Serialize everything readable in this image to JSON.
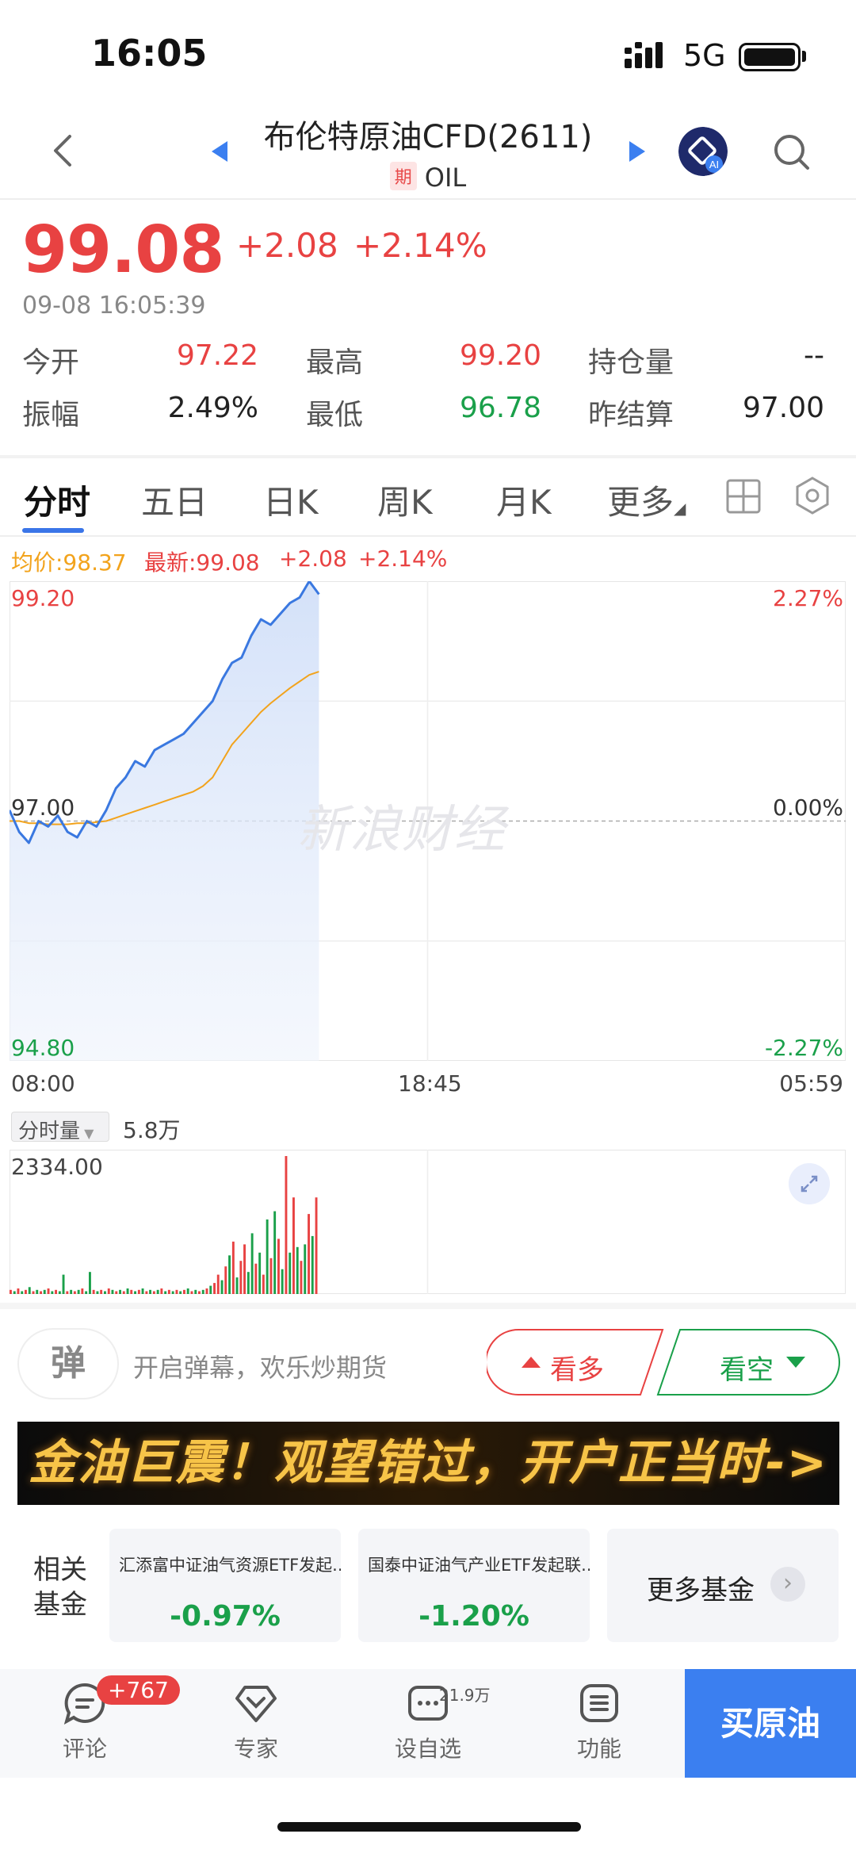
{
  "status": {
    "time": "16:05",
    "network": "5G"
  },
  "nav": {
    "title": "布伦特原油CFD(2611)",
    "tag": "期",
    "code": "OIL"
  },
  "quote": {
    "price": "99.08",
    "change": "+2.08",
    "change_pct": "+2.14%",
    "datetime": "09-08 16:05:39"
  },
  "stats": [
    {
      "label": "今开",
      "value": "97.22",
      "color": "red"
    },
    {
      "label": "最高",
      "value": "99.20",
      "color": "red"
    },
    {
      "label": "持仓量",
      "value": "--",
      "color": "dark"
    },
    {
      "label": "振幅",
      "value": "2.49%",
      "color": "dark"
    },
    {
      "label": "最低",
      "value": "96.78",
      "color": "green"
    },
    {
      "label": "昨结算",
      "value": "97.00",
      "color": "dark"
    }
  ],
  "tabs": [
    "分时",
    "五日",
    "日K",
    "周K",
    "月K",
    "更多"
  ],
  "legend": {
    "avg": "均价:98.37",
    "last": "最新:99.08",
    "chg": "+2.08",
    "pct": "+2.14%"
  },
  "chart": {
    "y_top": "99.20",
    "y_mid": "97.00",
    "y_bottom": "94.80",
    "pct_top": "2.27%",
    "pct_mid": "0.00%",
    "pct_bottom": "-2.27%",
    "x_start": "08:00",
    "x_mid": "18:45",
    "x_end": "05:59",
    "watermark": "新浪财经",
    "colors": {
      "price": "#3a78e0",
      "avg": "#f2a31c",
      "up": "#e84242",
      "down": "#1aa04a"
    }
  },
  "chart_data": {
    "type": "line",
    "title": "",
    "ylim": [
      94.8,
      99.2
    ],
    "x_labels": [
      "08:00",
      "18:45",
      "05:59"
    ],
    "series": [
      {
        "values": [
          97.1,
          96.9,
          96.8,
          97.0,
          96.95,
          97.05,
          96.9,
          96.85,
          97.0,
          96.95,
          97.1,
          97.3,
          97.4,
          97.55,
          97.5,
          97.65,
          97.7,
          97.75,
          97.8,
          97.9,
          98.0,
          98.1,
          98.3,
          98.45,
          98.5,
          98.7,
          98.85,
          98.8,
          98.9,
          99.0,
          99.05,
          99.2,
          99.08
        ]
      },
      {
        "values": [
          97.0,
          97.0,
          96.98,
          96.98,
          96.97,
          96.97,
          96.97,
          96.98,
          96.98,
          96.99,
          97.0,
          97.03,
          97.06,
          97.09,
          97.12,
          97.15,
          97.18,
          97.21,
          97.24,
          97.27,
          97.32,
          97.4,
          97.55,
          97.7,
          97.8,
          97.9,
          98.0,
          98.08,
          98.15,
          98.22,
          98.28,
          98.34,
          98.37
        ]
      }
    ]
  },
  "volume": {
    "button": "分时量",
    "total": "5.8万",
    "max_label": "2334.00",
    "bars": [
      3,
      2,
      4,
      2,
      3,
      5,
      2,
      3,
      2,
      3,
      4,
      2,
      3,
      2,
      14,
      2,
      3,
      2,
      3,
      4,
      2,
      16,
      3,
      2,
      3,
      2,
      4,
      3,
      2,
      3,
      2,
      4,
      3,
      2,
      3,
      4,
      2,
      3,
      2,
      3,
      4,
      2,
      3,
      2,
      3,
      2,
      3,
      4,
      2,
      3,
      2,
      3,
      4,
      6,
      8,
      14,
      10,
      20,
      28,
      38,
      12,
      24,
      36,
      16,
      44,
      22,
      30,
      14,
      54,
      26,
      60,
      40,
      18,
      100,
      30,
      70,
      34,
      24,
      36,
      58,
      42,
      70
    ],
    "bar_colors": [
      "r",
      "g",
      "r",
      "g",
      "r",
      "g",
      "r",
      "g",
      "r",
      "g",
      "r",
      "g",
      "r",
      "g",
      "g",
      "r",
      "g",
      "r",
      "g",
      "r",
      "g",
      "g",
      "r",
      "g",
      "r",
      "g",
      "r",
      "g",
      "r",
      "g",
      "r",
      "g",
      "r",
      "g",
      "r",
      "g",
      "r",
      "g",
      "r",
      "g",
      "r",
      "g",
      "r",
      "g",
      "r",
      "g",
      "r",
      "g",
      "r",
      "g",
      "r",
      "g",
      "r",
      "g",
      "r",
      "r",
      "g",
      "r",
      "g",
      "r",
      "g",
      "r",
      "r",
      "g",
      "g",
      "r",
      "g",
      "r",
      "g",
      "r",
      "g",
      "r",
      "g",
      "r",
      "g",
      "r",
      "g",
      "r",
      "g",
      "r",
      "g",
      "r"
    ]
  },
  "barrage": {
    "icon": "弹",
    "placeholder": "开启弹幕，欢乐炒期货",
    "bull": "看多",
    "bear": "看空"
  },
  "banner": {
    "text": "金油巨震！观望错过，开户正当时->"
  },
  "funds": {
    "label": "相关基金",
    "items": [
      {
        "name": "汇添富中证油气资源ETF发起...",
        "pct": "-0.97%"
      },
      {
        "name": "国泰中证油气产业ETF发起联...",
        "pct": "-1.20%"
      }
    ],
    "more": "更多基金"
  },
  "bottom": {
    "comment": "评论",
    "comment_badge": "+767",
    "expert": "专家",
    "watch": "设自选",
    "watch_badge": "21.9万",
    "func": "功能",
    "buy": "买原油"
  }
}
